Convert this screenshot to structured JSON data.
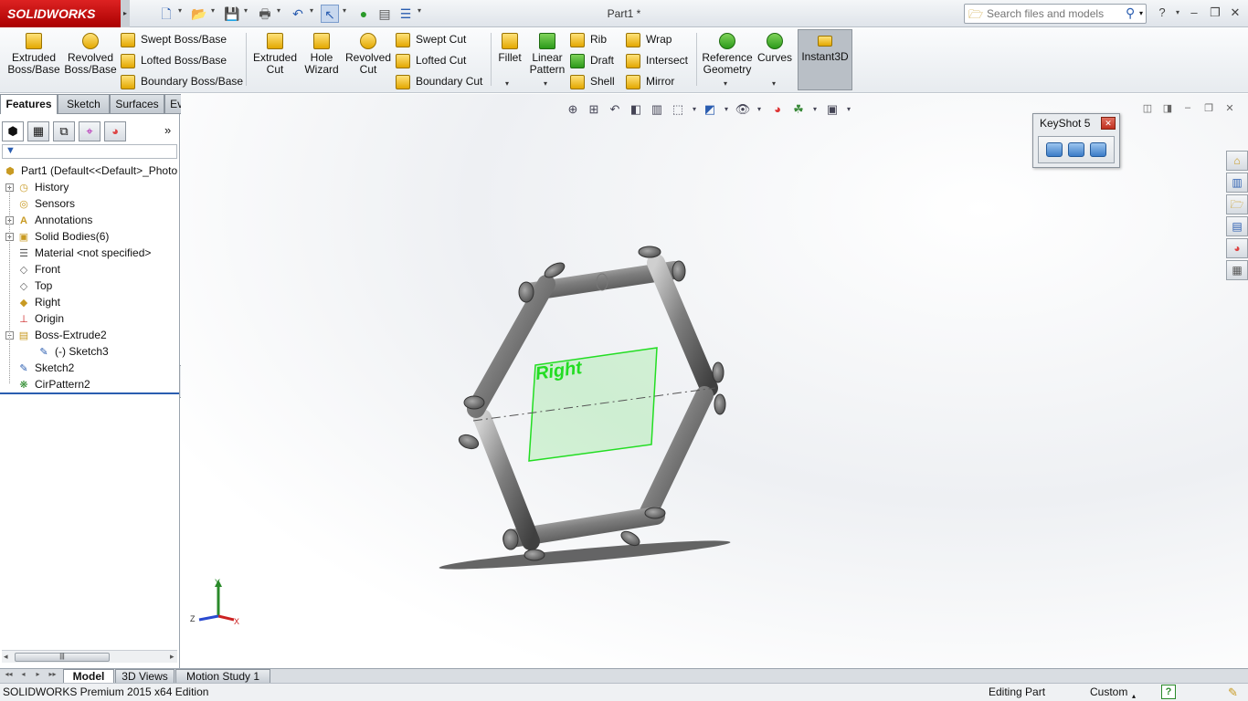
{
  "app": {
    "brand": "SOLIDWORKS",
    "document_title": "Part1 *"
  },
  "search": {
    "placeholder": "Search files and models"
  },
  "command_manager": {
    "extruded_boss": "Extruded\nBoss/Base",
    "revolved_boss": "Revolved\nBoss/Base",
    "swept_boss": "Swept Boss/Base",
    "lofted_boss": "Lofted Boss/Base",
    "boundary_boss": "Boundary Boss/Base",
    "extruded_cut": "Extruded\nCut",
    "hole_wizard": "Hole\nWizard",
    "revolved_cut": "Revolved\nCut",
    "swept_cut": "Swept Cut",
    "lofted_cut": "Lofted Cut",
    "boundary_cut": "Boundary Cut",
    "fillet": "Fillet",
    "linear_pattern": "Linear\nPattern",
    "rib": "Rib",
    "draft": "Draft",
    "shell": "Shell",
    "wrap": "Wrap",
    "intersect": "Intersect",
    "mirror": "Mirror",
    "reference_geometry": "Reference\nGeometry",
    "curves": "Curves",
    "instant3d": "Instant3D"
  },
  "tabs": [
    "Features",
    "Sketch",
    "Surfaces",
    "Evaluate"
  ],
  "feature_tree": {
    "root": "Part1  (Default<<Default>_Photo",
    "items": [
      {
        "label": "History",
        "icon": "history-icon",
        "expandable": true
      },
      {
        "label": "Sensors",
        "icon": "sensor-icon",
        "expandable": false
      },
      {
        "label": "Annotations",
        "icon": "annotation-icon",
        "expandable": true
      },
      {
        "label": "Solid Bodies(6)",
        "icon": "solid-bodies-icon",
        "expandable": true
      },
      {
        "label": "Material <not specified>",
        "icon": "material-icon",
        "expandable": false
      },
      {
        "label": "Front",
        "icon": "plane-icon",
        "expandable": false
      },
      {
        "label": "Top",
        "icon": "plane-icon",
        "expandable": false
      },
      {
        "label": "Right",
        "icon": "plane-icon",
        "expandable": false
      },
      {
        "label": "Origin",
        "icon": "origin-icon",
        "expandable": false
      },
      {
        "label": "Boss-Extrude2",
        "icon": "extrude-icon",
        "expandable": true
      },
      {
        "label": "(-) Sketch3",
        "icon": "sketch-icon",
        "expandable": false
      },
      {
        "label": "Sketch2",
        "icon": "sketch-icon",
        "expandable": false
      },
      {
        "label": "CirPattern2",
        "icon": "circular-pattern-icon",
        "expandable": false
      }
    ]
  },
  "viewport": {
    "plane_label": "Right"
  },
  "keyshot": {
    "title": "KeyShot 5"
  },
  "bottom_tabs": [
    "Model",
    "3D Views",
    "Motion Study 1"
  ],
  "status": {
    "edition": "SOLIDWORKS Premium 2015 x64 Edition",
    "mode": "Editing Part",
    "units": "Custom"
  },
  "colors": {
    "brand_red": "#c41a1a",
    "plane_green": "#22dd22",
    "selection_blue": "#2a5db0"
  }
}
